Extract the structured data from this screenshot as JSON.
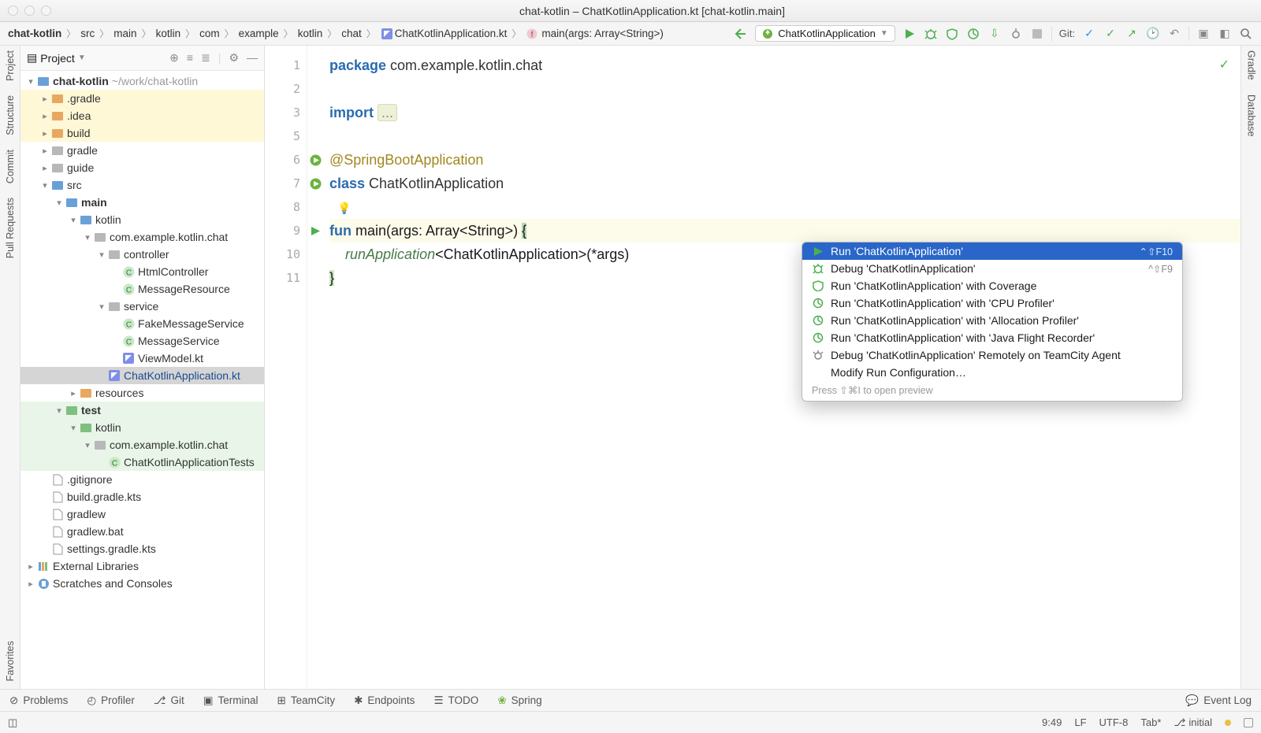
{
  "window": {
    "title": "chat-kotlin – ChatKotlinApplication.kt [chat-kotlin.main]"
  },
  "breadcrumbs": [
    "chat-kotlin",
    "src",
    "main",
    "kotlin",
    "com",
    "example",
    "kotlin",
    "chat",
    "ChatKotlinApplication.kt",
    "main(args: Array<String>)"
  ],
  "runConfig": "ChatKotlinApplication",
  "gitLabel": "Git:",
  "leftRail": {
    "project": "Project",
    "structure": "Structure",
    "commit": "Commit",
    "pullrequests": "Pull Requests",
    "favorites": "Favorites"
  },
  "rightRail": {
    "gradle": "Gradle",
    "database": "Database"
  },
  "projectHeader": {
    "label": "Project"
  },
  "tree": [
    {
      "d": 0,
      "a": "down",
      "ic": "folder-blue",
      "t": "chat-kotlin",
      "path": "~/work/chat-kotlin",
      "bold": true
    },
    {
      "d": 1,
      "a": "right",
      "ic": "folder-orange",
      "t": ".gradle",
      "hl": "yellow"
    },
    {
      "d": 1,
      "a": "right",
      "ic": "folder-orange",
      "t": ".idea",
      "hl": "yellow"
    },
    {
      "d": 1,
      "a": "right",
      "ic": "folder-orange",
      "t": "build",
      "hl": "yellow"
    },
    {
      "d": 1,
      "a": "right",
      "ic": "folder-gray",
      "t": "gradle"
    },
    {
      "d": 1,
      "a": "right",
      "ic": "folder-gray",
      "t": "guide"
    },
    {
      "d": 1,
      "a": "down",
      "ic": "folder-blue",
      "t": "src"
    },
    {
      "d": 2,
      "a": "down",
      "ic": "folder-blue",
      "t": "main",
      "bold": true
    },
    {
      "d": 3,
      "a": "down",
      "ic": "folder-blue",
      "t": "kotlin"
    },
    {
      "d": 4,
      "a": "down",
      "ic": "folder-gray",
      "t": "com.example.kotlin.chat"
    },
    {
      "d": 5,
      "a": "down",
      "ic": "folder-gray",
      "t": "controller"
    },
    {
      "d": 6,
      "a": "none",
      "ic": "class",
      "t": "HtmlController"
    },
    {
      "d": 6,
      "a": "none",
      "ic": "class",
      "t": "MessageResource"
    },
    {
      "d": 5,
      "a": "down",
      "ic": "folder-gray",
      "t": "service"
    },
    {
      "d": 6,
      "a": "none",
      "ic": "class",
      "t": "FakeMessageService"
    },
    {
      "d": 6,
      "a": "none",
      "ic": "class",
      "t": "MessageService"
    },
    {
      "d": 6,
      "a": "none",
      "ic": "kt",
      "t": "ViewModel.kt"
    },
    {
      "d": 5,
      "a": "none",
      "ic": "kt",
      "t": "ChatKotlinApplication.kt",
      "sel": true,
      "blue": true
    },
    {
      "d": 3,
      "a": "right",
      "ic": "folder-orange",
      "t": "resources"
    },
    {
      "d": 2,
      "a": "down",
      "ic": "folder-green",
      "t": "test",
      "hl": "green",
      "bold": true
    },
    {
      "d": 3,
      "a": "down",
      "ic": "folder-green",
      "t": "kotlin",
      "hl": "green"
    },
    {
      "d": 4,
      "a": "down",
      "ic": "folder-gray",
      "t": "com.example.kotlin.chat",
      "hl": "green"
    },
    {
      "d": 5,
      "a": "none",
      "ic": "class",
      "t": "ChatKotlinApplicationTests",
      "hl": "green"
    },
    {
      "d": 1,
      "a": "none",
      "ic": "file",
      "t": ".gitignore"
    },
    {
      "d": 1,
      "a": "none",
      "ic": "file",
      "t": "build.gradle.kts"
    },
    {
      "d": 1,
      "a": "none",
      "ic": "file",
      "t": "gradlew"
    },
    {
      "d": 1,
      "a": "none",
      "ic": "file",
      "t": "gradlew.bat"
    },
    {
      "d": 1,
      "a": "none",
      "ic": "file",
      "t": "settings.gradle.kts"
    },
    {
      "d": 0,
      "a": "right",
      "ic": "lib",
      "t": "External Libraries"
    },
    {
      "d": 0,
      "a": "right",
      "ic": "scratch",
      "t": "Scratches and Consoles"
    }
  ],
  "editor": {
    "lines": [
      1,
      2,
      3,
      5,
      6,
      7,
      8,
      9,
      10,
      11
    ],
    "code": {
      "l1_kw": "package",
      "l1_pkg": " com.example.kotlin.chat",
      "l3_kw": "import ",
      "l3_fold": "...",
      "l6_ann": "@SpringBootApplication",
      "l7_kw": "class ",
      "l7_cls": "ChatKotlinApplication",
      "l9_kw": "fun ",
      "l9_name": "main",
      "l9_args": "(args: Array<String>) ",
      "l9_brace": "{",
      "l10_fn": "runApplication",
      "l10_generic": "<ChatKotlinApplication>(*args)",
      "l11_brace": "}"
    }
  },
  "contextMenu": {
    "items": [
      {
        "ic": "run",
        "t": "Run 'ChatKotlinApplication'",
        "sc": "⌃⇧F10",
        "sel": true
      },
      {
        "ic": "debug",
        "t": "Debug 'ChatKotlinApplication'",
        "sc": "^⇧F9"
      },
      {
        "ic": "cov",
        "t": "Run 'ChatKotlinApplication' with Coverage"
      },
      {
        "ic": "prof",
        "t": "Run 'ChatKotlinApplication' with 'CPU Profiler'"
      },
      {
        "ic": "prof",
        "t": "Run 'ChatKotlinApplication' with 'Allocation Profiler'"
      },
      {
        "ic": "prof",
        "t": "Run 'ChatKotlinApplication' with 'Java Flight Recorder'"
      },
      {
        "ic": "remote",
        "t": "Debug 'ChatKotlinApplication' Remotely on TeamCity Agent"
      },
      {
        "ic": "none",
        "t": "Modify Run Configuration…"
      }
    ],
    "footer": "Press ⇧⌘I to open preview"
  },
  "toolStrip": {
    "problems": "Problems",
    "profiler": "Profiler",
    "git": "Git",
    "terminal": "Terminal",
    "teamcity": "TeamCity",
    "endpoints": "Endpoints",
    "todo": "TODO",
    "spring": "Spring",
    "eventlog": "Event Log"
  },
  "status": {
    "pos": "9:49",
    "le": "LF",
    "enc": "UTF-8",
    "tab": "Tab*",
    "branch": "initial"
  }
}
